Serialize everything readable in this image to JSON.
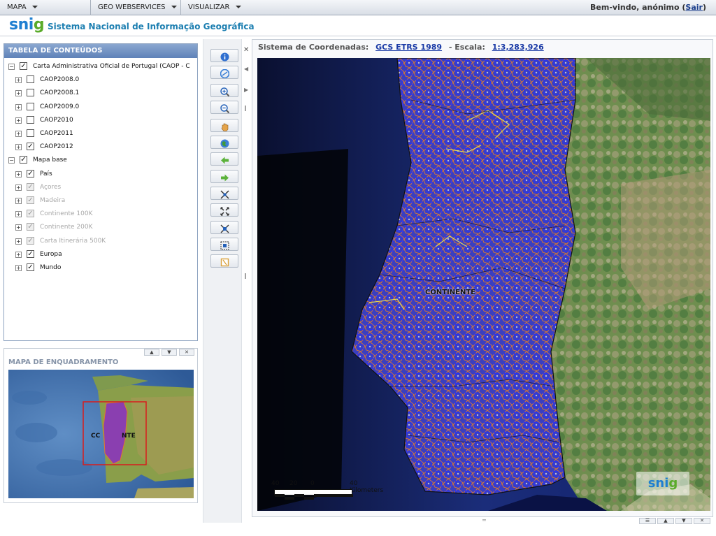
{
  "menubar": {
    "items": [
      {
        "label": "MAPA"
      },
      {
        "label": "GEO WEBSERVICES"
      },
      {
        "label": "VISUALIZAR"
      }
    ],
    "welcome": "Bem-vindo, anónimo",
    "logout": "Sair"
  },
  "header": {
    "logo_text": "snig",
    "title": "Sistema Nacional de Informação Geográfica"
  },
  "toc": {
    "title": "TABELA DE CONTEÚDOS",
    "items": [
      {
        "label": "Carta Administrativa Oficial de Portugal (CAOP - C",
        "checked": true,
        "disabled": false,
        "level": 0,
        "expanded": true
      },
      {
        "label": "CAOP2008.0",
        "checked": false,
        "disabled": false,
        "level": 1
      },
      {
        "label": "CAOP2008.1",
        "checked": false,
        "disabled": false,
        "level": 1
      },
      {
        "label": "CAOP2009.0",
        "checked": false,
        "disabled": false,
        "level": 1
      },
      {
        "label": "CAOP2010",
        "checked": false,
        "disabled": false,
        "level": 1
      },
      {
        "label": "CAOP2011",
        "checked": false,
        "disabled": false,
        "level": 1
      },
      {
        "label": "CAOP2012",
        "checked": true,
        "disabled": false,
        "level": 1
      },
      {
        "label": "Mapa base",
        "checked": true,
        "disabled": false,
        "level": 0,
        "expanded": true
      },
      {
        "label": "País",
        "checked": true,
        "disabled": false,
        "level": 1
      },
      {
        "label": "Açores",
        "checked": true,
        "disabled": true,
        "level": 1
      },
      {
        "label": "Madeira",
        "checked": true,
        "disabled": true,
        "level": 1
      },
      {
        "label": "Continente 100K",
        "checked": true,
        "disabled": true,
        "level": 1
      },
      {
        "label": "Continente 200K",
        "checked": true,
        "disabled": true,
        "level": 1
      },
      {
        "label": "Carta Itinerária 500K",
        "checked": true,
        "disabled": true,
        "level": 1
      },
      {
        "label": "Europa",
        "checked": true,
        "disabled": false,
        "level": 1
      },
      {
        "label": "Mundo",
        "checked": true,
        "disabled": false,
        "level": 1
      }
    ]
  },
  "overview": {
    "title": "MAPA DE ENQUADRAMENTO",
    "label_left": "CC",
    "label_right": "NTE"
  },
  "toolbar": {
    "tools": [
      {
        "icon": "info-icon",
        "color": "#2f6fd0"
      },
      {
        "icon": "measure-icon",
        "color": "#3a7fd6"
      },
      {
        "icon": "zoom-in-icon",
        "color": "#2360b8"
      },
      {
        "icon": "zoom-out-icon",
        "color": "#2360b8"
      },
      {
        "icon": "pan-hand-icon",
        "color": "#e5a44a"
      },
      {
        "icon": "globe-icon",
        "color": "#3f9a3a"
      },
      {
        "icon": "back-arrow-icon",
        "color": "#5bb23a"
      },
      {
        "icon": "forward-arrow-icon",
        "color": "#5bb23a"
      },
      {
        "icon": "zoom-to-layer-in-icon",
        "color": "#333333"
      },
      {
        "icon": "zoom-to-layer-out-icon",
        "color": "#333333"
      },
      {
        "icon": "zoom-full-extent-icon",
        "color": "#2360b8"
      },
      {
        "icon": "zoom-box-icon",
        "color": "#2360b8"
      },
      {
        "icon": "clear-icon",
        "color": "#d9a03a"
      }
    ]
  },
  "map": {
    "coord_label": "Sistema de Coordenadas:",
    "coord_system": "GCS ETRS 1989",
    "scale_label": "- Escala:",
    "scale_value": "1:3,283,926",
    "region_label": "CONTINENTE",
    "scalebar": {
      "n1": "40",
      "n2": "20",
      "n3": "0",
      "n4": "40 Kilometers"
    },
    "watermark": "snig"
  }
}
